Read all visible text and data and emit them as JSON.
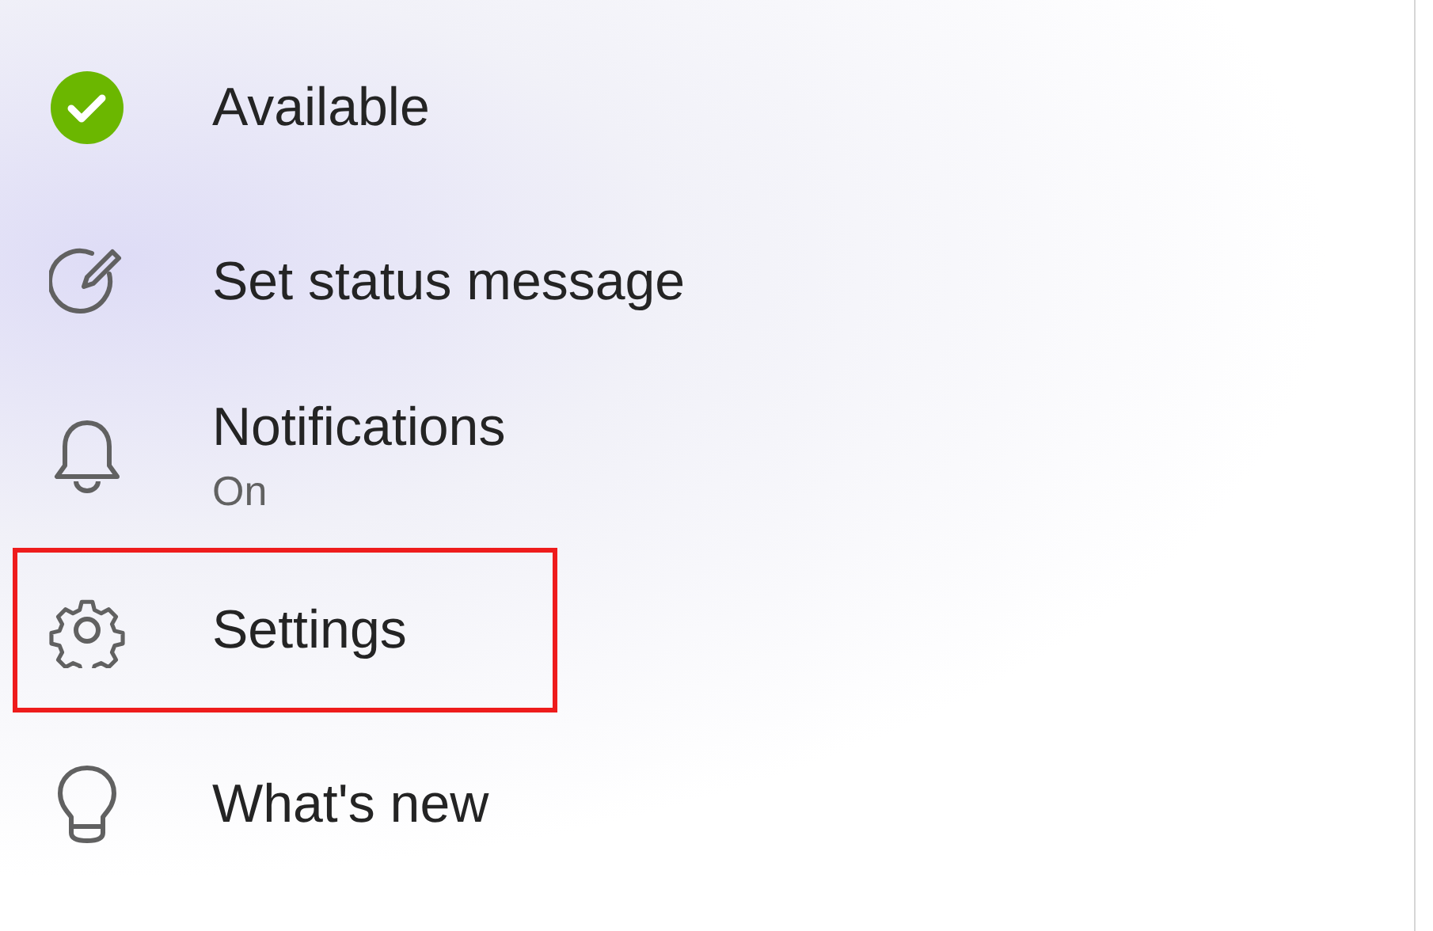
{
  "menu": {
    "items": [
      {
        "kind": "presence",
        "label": "Available",
        "highlighted": false
      },
      {
        "kind": "status-message",
        "label": "Set status message",
        "highlighted": false
      },
      {
        "kind": "notifications",
        "label": "Notifications",
        "detail": "On",
        "highlighted": false
      },
      {
        "kind": "settings",
        "label": "Settings",
        "highlighted": true
      },
      {
        "kind": "whats-new",
        "label": "What's new",
        "highlighted": false
      }
    ]
  }
}
